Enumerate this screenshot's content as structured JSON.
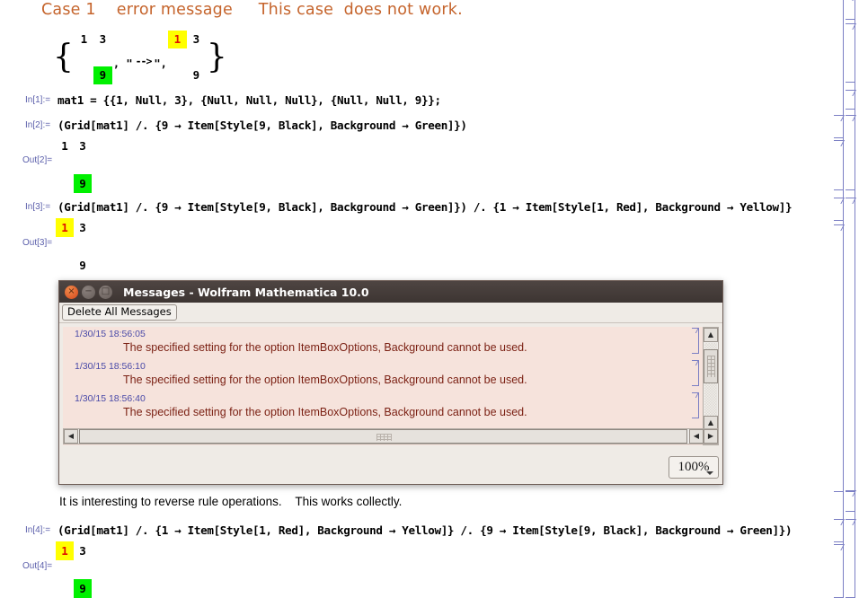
{
  "notebook": {
    "section_title": "Case 1    error message     This case  does not work.",
    "rule_display": {
      "left_grid": [
        [
          "1",
          "3"
        ],
        [
          "",
          ""
        ],
        [
          "",
          "9"
        ]
      ],
      "separator": ", \"",
      "arrow": "-->",
      "separator2": "\",",
      "right_grid": [
        [
          "1",
          "3"
        ],
        [
          "",
          ""
        ],
        [
          "",
          "9"
        ]
      ],
      "open_brace": "{",
      "close_brace": "}"
    },
    "cells": [
      {
        "in_label": "In[1]:=",
        "code": "mat1 = {{1, Null, 3}, {Null, Null, Null}, {Null, Null, 9}};"
      },
      {
        "in_label": "In[2]:=",
        "code": "(Grid[mat1] /. {9 → Item[Style[9, Black], Background → Green]})",
        "out_label": "Out[2]=",
        "out_grid": [
          [
            "1",
            "3"
          ],
          [
            "",
            ""
          ],
          [
            "",
            "9"
          ]
        ]
      },
      {
        "in_label": "In[3]:=",
        "code": "(Grid[mat1] /. {9 → Item[Style[9, Black], Background → Green]}) /. {1 → Item[Style[1, Red], Background → Yellow]}",
        "out_label": "Out[3]=",
        "out_grid": [
          [
            "1",
            "3"
          ],
          [
            "",
            ""
          ],
          [
            "",
            "9"
          ]
        ]
      },
      {
        "in_label": "In[4]:=",
        "code": "(Grid[mat1] /. {1 → Item[Style[1, Red], Background → Yellow]} /. {9 → Item[Style[9, Black], Background → Green]})",
        "out_label": "Out[4]=",
        "out_grid": [
          [
            "1",
            "3"
          ],
          [
            "",
            ""
          ],
          [
            "",
            "9"
          ]
        ]
      }
    ],
    "note_text": "It is interesting to reverse rule operations.    This works collectly."
  },
  "messages_window": {
    "title": "Messages - Wolfram Mathematica 10.0",
    "close_glyph": "×",
    "minimize_glyph": "−",
    "maximize_glyph": "□",
    "delete_all_label": "Delete All Messages",
    "messages": [
      {
        "time": "1/30/15 18:56:05",
        "text": "The specified setting for the option ItemBoxOptions, Background cannot be used."
      },
      {
        "time": "1/30/15 18:56:10",
        "text": "The specified setting for the option ItemBoxOptions, Background cannot be used."
      },
      {
        "time": "1/30/15 18:56:40",
        "text": "The specified setting for the option ItemBoxOptions, Background cannot be used."
      }
    ],
    "scroll_up_glyph": "▲",
    "scroll_down_glyph": "▼",
    "scroll_left_glyph": "◀",
    "scroll_right_glyph": "▶",
    "zoom_level": "100%"
  },
  "colors": {
    "heading": "#c5642c",
    "green_cell": "#00f000",
    "yellow_cell": "#ffff00",
    "red_text": "#e01000",
    "message_bg": "#f6e3dc",
    "message_text": "#7a1f12",
    "timestamp": "#4a4aa8",
    "bracket": "#7b7fc4",
    "io_label": "#5b5fab",
    "titlebar": "#413936"
  }
}
